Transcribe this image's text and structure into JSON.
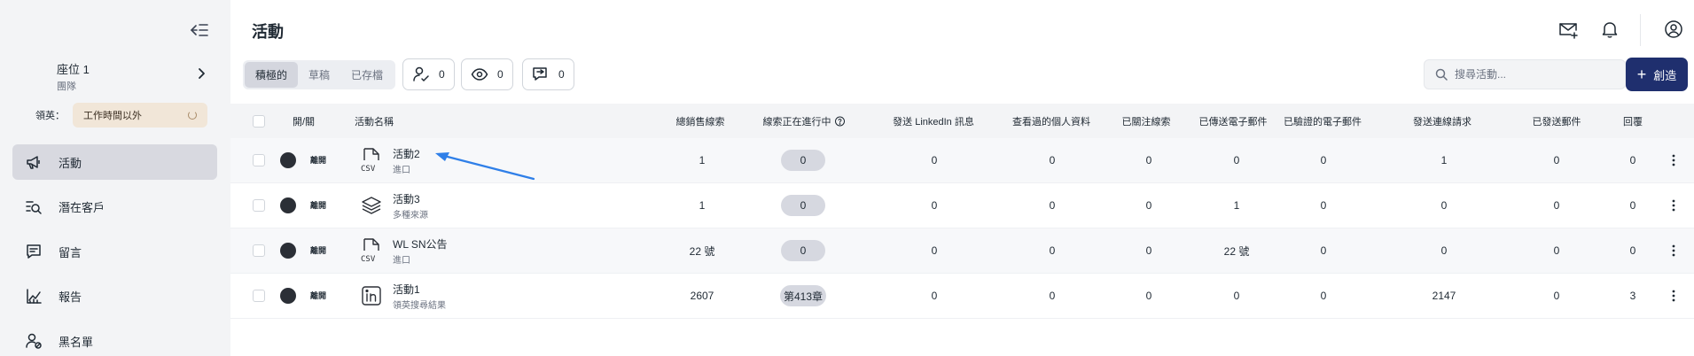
{
  "sidebar": {
    "seat": {
      "name": "座位 1",
      "team": "團隊"
    },
    "lead": {
      "label": "領英：",
      "status": "工作時間以外"
    },
    "items": [
      {
        "label": "活動",
        "icon": "megaphone-icon",
        "active": true
      },
      {
        "label": "潛在客戶",
        "icon": "search-list-icon",
        "active": false
      },
      {
        "label": "留言",
        "icon": "message-icon",
        "active": false
      },
      {
        "label": "報告",
        "icon": "chart-icon",
        "active": false
      },
      {
        "label": "黑名單",
        "icon": "user-block-icon",
        "active": false
      }
    ]
  },
  "header": {
    "title": "活動"
  },
  "filters": {
    "tabs": [
      {
        "label": "積極的",
        "active": true
      },
      {
        "label": "草稿",
        "active": false
      },
      {
        "label": "已存檔",
        "active": false
      }
    ],
    "stats": [
      {
        "icon": "user-check-icon",
        "value": "0"
      },
      {
        "icon": "eye-icon",
        "value": "0"
      },
      {
        "icon": "reply-icon",
        "value": "0"
      }
    ]
  },
  "search": {
    "placeholder": "搜尋活動..."
  },
  "create": {
    "label": "創造"
  },
  "table": {
    "headers": {
      "toggle": "開/關",
      "name": "活動名稱",
      "total_leads": "總銷售線索",
      "in_progress": "線索正在進行中",
      "linkedin_msgs": "發送 LinkedIn 訊息",
      "viewed_profiles": "查看過的個人資料",
      "followed": "已關注線索",
      "emails_sent": "已傳送電子郵件",
      "emails_verified": "已驗證的電子郵件",
      "connection_requests": "發送連線請求",
      "mails_sent": "已發送郵件",
      "replies": "回覆"
    },
    "rows": [
      {
        "name": "活動2",
        "source": "進口",
        "type": "csv",
        "toggle": "離開",
        "total_leads": "1",
        "in_progress": "0",
        "linkedin_msgs": "0",
        "viewed_profiles": "0",
        "followed": "0",
        "emails_sent": "0",
        "emails_verified": "0",
        "connection_requests": "1",
        "mails_sent": "0",
        "replies": "0"
      },
      {
        "name": "活動3",
        "source": "多種來源",
        "type": "layers",
        "toggle": "離開",
        "total_leads": "1",
        "in_progress": "0",
        "linkedin_msgs": "0",
        "viewed_profiles": "0",
        "followed": "0",
        "emails_sent": "1",
        "emails_verified": "0",
        "connection_requests": "0",
        "mails_sent": "0",
        "replies": "0"
      },
      {
        "name": "WL SN公告",
        "source": "進口",
        "type": "csv",
        "toggle": "離開",
        "total_leads": "22 號",
        "in_progress": "0",
        "linkedin_msgs": "0",
        "viewed_profiles": "0",
        "followed": "0",
        "emails_sent": "22 號",
        "emails_verified": "0",
        "connection_requests": "0",
        "mails_sent": "0",
        "replies": "0"
      },
      {
        "name": "活動1",
        "source": "領英搜尋結果",
        "type": "linkedin",
        "toggle": "離開",
        "total_leads": "2607",
        "in_progress": "第413章",
        "linkedin_msgs": "0",
        "viewed_profiles": "0",
        "followed": "0",
        "emails_sent": "0",
        "emails_verified": "0",
        "connection_requests": "2147",
        "mails_sent": "0",
        "replies": "3"
      }
    ]
  },
  "colors": {
    "primary": "#1f2f6e",
    "active_nav": "#d8d9e0",
    "lead_pill": "#f1e6d8",
    "arrow": "#2f7fe8"
  }
}
